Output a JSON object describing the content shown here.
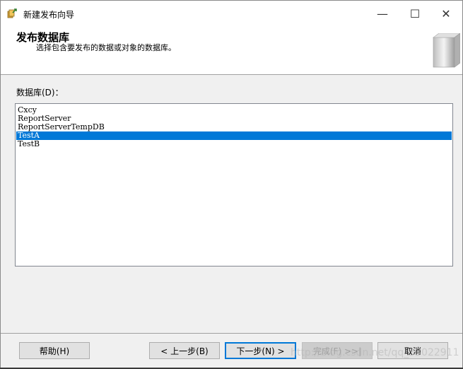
{
  "window": {
    "title": "新建发布向导",
    "minimize": "—",
    "maximize": "☐",
    "close": "✕"
  },
  "header": {
    "title": "发布数据库",
    "subtitle": "选择包含要发布的数据或对象的数据库。"
  },
  "databases": {
    "label": "数据库(D)：",
    "items": [
      "Cxcy",
      "ReportServer",
      "ReportServerTempDB",
      "TestA",
      "TestB"
    ],
    "selected": "TestA"
  },
  "footer": {
    "help": "帮助(H)",
    "prev": "< 上一步(B)",
    "next": "下一步(N) >",
    "finish": "完成(F) >>|",
    "cancel": "取消"
  },
  "watermark": "http://blog.csdn.net/qq_33022911",
  "colors": {
    "selection": "#0078d7",
    "focus_border": "#0078d7"
  }
}
